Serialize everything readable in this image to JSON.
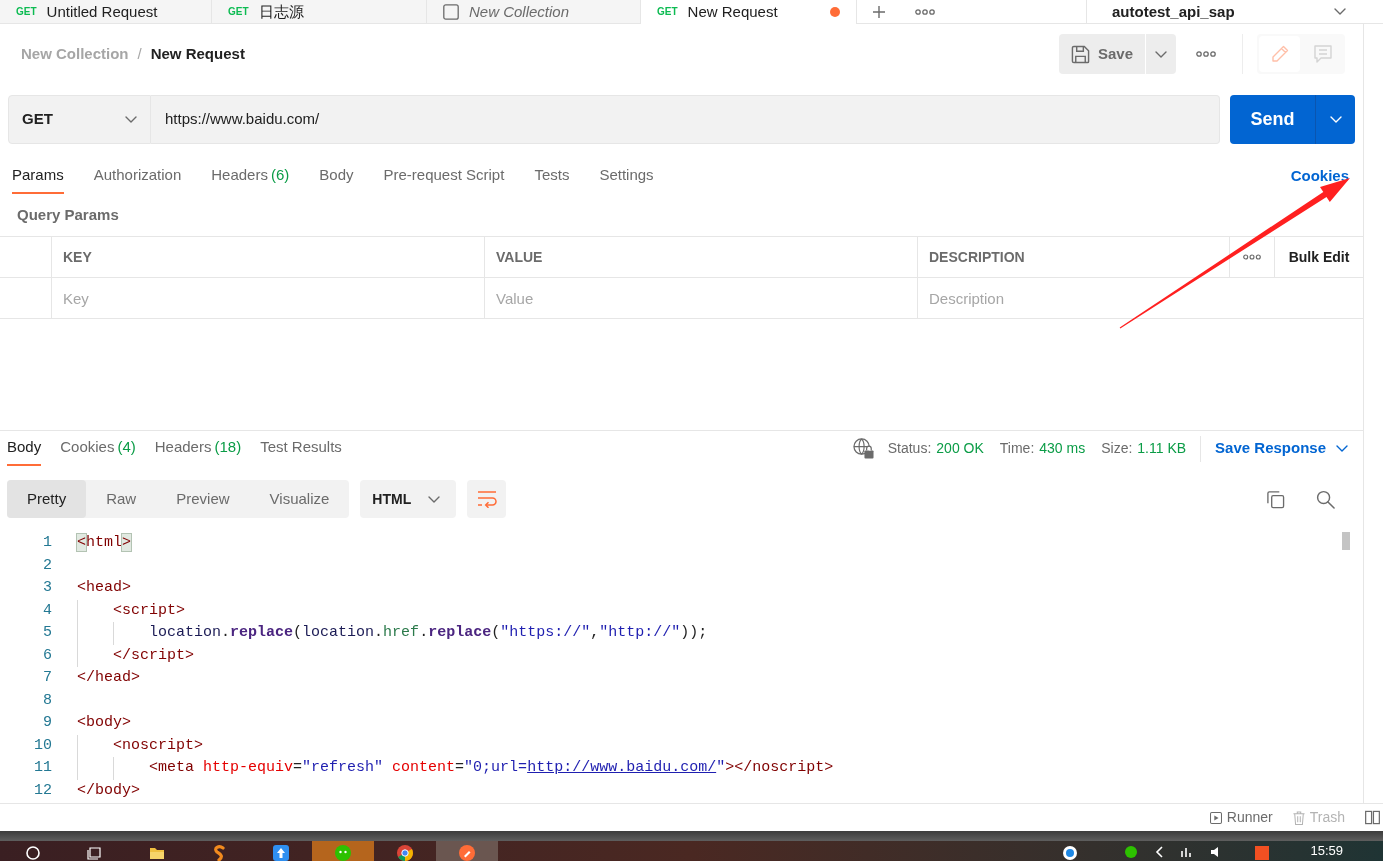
{
  "tabs": [
    {
      "kind": "request",
      "method": "GET",
      "label": "Untitled Request",
      "selected": false,
      "unsaved": false
    },
    {
      "kind": "request",
      "method": "GET",
      "label": "日志源",
      "selected": false,
      "unsaved": false
    },
    {
      "kind": "collection",
      "label": "New Collection",
      "selected": false,
      "unsaved": false
    },
    {
      "kind": "request",
      "method": "GET",
      "label": "New Request",
      "selected": true,
      "unsaved": true
    }
  ],
  "environment": {
    "name": "autotest_api_sap"
  },
  "breadcrumb": {
    "collection": "New Collection",
    "separator": "/",
    "request": "New Request"
  },
  "actions": {
    "save": "Save",
    "modes": [
      {
        "kind": "edit",
        "selected": true
      },
      {
        "kind": "comments",
        "selected": false
      }
    ]
  },
  "request": {
    "method": "GET",
    "url": "https://www.baidu.com/",
    "send": "Send"
  },
  "request_tabs": [
    {
      "label": "Params",
      "selected": true
    },
    {
      "label": "Authorization",
      "selected": false
    },
    {
      "label": "Headers",
      "count": "(6)",
      "selected": false
    },
    {
      "label": "Body",
      "selected": false
    },
    {
      "label": "Pre-request Script",
      "selected": false
    },
    {
      "label": "Tests",
      "selected": false
    },
    {
      "label": "Settings",
      "selected": false
    }
  ],
  "cookies_link": "Cookies",
  "query_params": {
    "title": "Query Params",
    "columns": [
      "KEY",
      "VALUE",
      "DESCRIPTION"
    ],
    "bulk_edit": "Bulk Edit",
    "placeholders": [
      "Key",
      "Value",
      "Description"
    ]
  },
  "response": {
    "tabs": [
      {
        "label": "Body",
        "selected": true
      },
      {
        "label": "Cookies",
        "count": "(4)",
        "selected": false
      },
      {
        "label": "Headers",
        "count": "(18)",
        "selected": false
      },
      {
        "label": "Test Results",
        "selected": false
      }
    ],
    "stats": [
      {
        "label": "Status:",
        "value": "200 OK"
      },
      {
        "label": "Time:",
        "value": "430 ms"
      },
      {
        "label": "Size:",
        "value": "1.11 KB"
      }
    ],
    "save_response": "Save Response",
    "views": [
      {
        "label": "Pretty",
        "selected": true
      },
      {
        "label": "Raw",
        "selected": false
      },
      {
        "label": "Preview",
        "selected": false
      },
      {
        "label": "Visualize",
        "selected": false
      }
    ],
    "language": "HTML",
    "wrap_lines": true,
    "lines": [
      {
        "number": "1",
        "tokens": [
          {
            "text": "<",
            "kind": "bracket-match"
          },
          {
            "text": "html",
            "kind": "tag"
          },
          {
            "text": ">",
            "kind": "bracket-match"
          }
        ]
      },
      {
        "number": "2"
      },
      {
        "number": "3",
        "tokens": [
          {
            "text": "<head>",
            "kind": "tag"
          }
        ]
      },
      {
        "number": "4",
        "tokens": [
          {
            "text": "    <script>",
            "kind": "tag"
          }
        ]
      },
      {
        "number": "5",
        "tokens": [
          {
            "text": "        location",
            "kind": "variable"
          },
          {
            "text": ".",
            "kind": "text"
          },
          {
            "text": "replace",
            "kind": "method"
          },
          {
            "text": "(",
            "kind": "text"
          },
          {
            "text": "location",
            "kind": "variable"
          },
          {
            "text": ".",
            "kind": "text"
          },
          {
            "text": "href",
            "kind": "property"
          },
          {
            "text": ".",
            "kind": "text"
          },
          {
            "text": "replace",
            "kind": "method"
          },
          {
            "text": "(",
            "kind": "text"
          },
          {
            "text": "\"https://\"",
            "kind": "string"
          },
          {
            "text": ",",
            "kind": "text"
          },
          {
            "text": "\"http://\"",
            "kind": "string"
          },
          {
            "text": "));",
            "kind": "text"
          }
        ]
      },
      {
        "number": "6",
        "tokens": [
          {
            "text": "    </script>",
            "kind": "tag"
          }
        ]
      },
      {
        "number": "7",
        "tokens": [
          {
            "text": "</head>",
            "kind": "tag"
          }
        ]
      },
      {
        "number": "8"
      },
      {
        "number": "9",
        "tokens": [
          {
            "text": "<body>",
            "kind": "tag"
          }
        ]
      },
      {
        "number": "10",
        "tokens": [
          {
            "text": "    <noscript>",
            "kind": "tag"
          }
        ]
      },
      {
        "number": "11",
        "tokens": [
          {
            "text": "        <meta ",
            "kind": "tag"
          },
          {
            "text": "http-equiv",
            "kind": "attribute"
          },
          {
            "text": "=",
            "kind": "text"
          },
          {
            "text": "\"refresh\" ",
            "kind": "string"
          },
          {
            "text": "content",
            "kind": "attribute"
          },
          {
            "text": "=",
            "kind": "text"
          },
          {
            "text": "\"0;url=",
            "kind": "string"
          },
          {
            "text": "http://www.baidu.com/",
            "kind": "link"
          },
          {
            "text": "\"",
            "kind": "string"
          },
          {
            "text": "></noscript>",
            "kind": "tag"
          }
        ]
      },
      {
        "number": "12",
        "tokens": [
          {
            "text": "</body>",
            "kind": "tag"
          }
        ]
      }
    ]
  },
  "status_bar": [
    {
      "kind": "runner",
      "label": "Runner",
      "disabled": false
    },
    {
      "kind": "trash",
      "label": "Trash",
      "disabled": true
    }
  ],
  "taskbar": {
    "apps": [
      {
        "kind": "search",
        "selected": false,
        "attention": false
      },
      {
        "kind": "taskview",
        "selected": false,
        "attention": false
      },
      {
        "kind": "folder",
        "selected": false,
        "attention": false
      },
      {
        "kind": "curve",
        "selected": false,
        "attention": false
      },
      {
        "kind": "tile",
        "selected": false,
        "attention": false
      },
      {
        "kind": "chat",
        "selected": false,
        "attention": true
      },
      {
        "kind": "browser",
        "selected": false,
        "attention": false
      },
      {
        "kind": "postman",
        "selected": true,
        "attention": false
      }
    ],
    "clock": "15:59"
  }
}
